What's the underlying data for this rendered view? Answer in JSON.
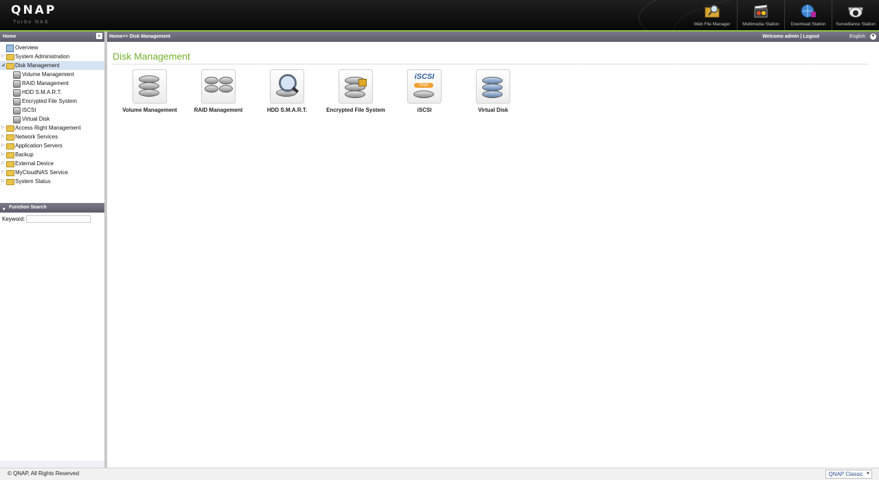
{
  "header": {
    "brand": "QNAP",
    "brand_sub": "Turbo NAS",
    "apps": [
      {
        "label": "Web File Manager",
        "icon": "folder-magnifier-icon"
      },
      {
        "label": "Multimedia Station",
        "icon": "film-clapper-icon"
      },
      {
        "label": "Download Station",
        "icon": "download-globe-icon"
      },
      {
        "label": "Surveillance Station",
        "icon": "security-camera-icon"
      }
    ]
  },
  "sidebar": {
    "title": "Home",
    "collapse_glyph": "«",
    "tree": [
      {
        "label": "Overview"
      },
      {
        "label": "System Administration"
      },
      {
        "label": "Disk Management",
        "selected": true
      },
      {
        "label": "Volume Management"
      },
      {
        "label": "RAID Management"
      },
      {
        "label": "HDD S.M.A.R.T."
      },
      {
        "label": "Encrypted File System"
      },
      {
        "label": "iSCSI"
      },
      {
        "label": "Virtual Disk"
      },
      {
        "label": "Access Right Management"
      },
      {
        "label": "Network Services"
      },
      {
        "label": "Application Servers"
      },
      {
        "label": "Backup"
      },
      {
        "label": "External Device"
      },
      {
        "label": "MyCloudNAS Service"
      },
      {
        "label": "System Status"
      }
    ]
  },
  "function_search": {
    "title": "Function Search",
    "keyword_label": "Keyword:",
    "keyword_value": ""
  },
  "topbar": {
    "breadcrumb": "Home>> Disk Management",
    "welcome": "Welcome admin | Logout",
    "language": "English"
  },
  "main": {
    "title": "Disk Management",
    "tiles": [
      {
        "label": "Volume Management",
        "icon": "volume-disks-icon"
      },
      {
        "label": "RAID Management",
        "icon": "raid-disks-icon"
      },
      {
        "label": "HDD S.M.A.R.T.",
        "icon": "hdd-smart-magnifier-icon"
      },
      {
        "label": "Encrypted File System",
        "icon": "encrypted-disk-lock-icon"
      },
      {
        "label": "iSCSI",
        "icon": "iscsi-target-icon",
        "badge": "iSCSI",
        "sub": "Target"
      },
      {
        "label": "Virtual Disk",
        "icon": "virtual-disk-icon"
      }
    ]
  },
  "footer": {
    "copyright": "© QNAP, All Rights Reserved",
    "theme": "QNAP Classic"
  },
  "colors": {
    "accent_green": "#8ec63f",
    "title_green": "#74b02b",
    "header_bg": "#0e0e0e",
    "bar_gray": "#6a6a78"
  }
}
